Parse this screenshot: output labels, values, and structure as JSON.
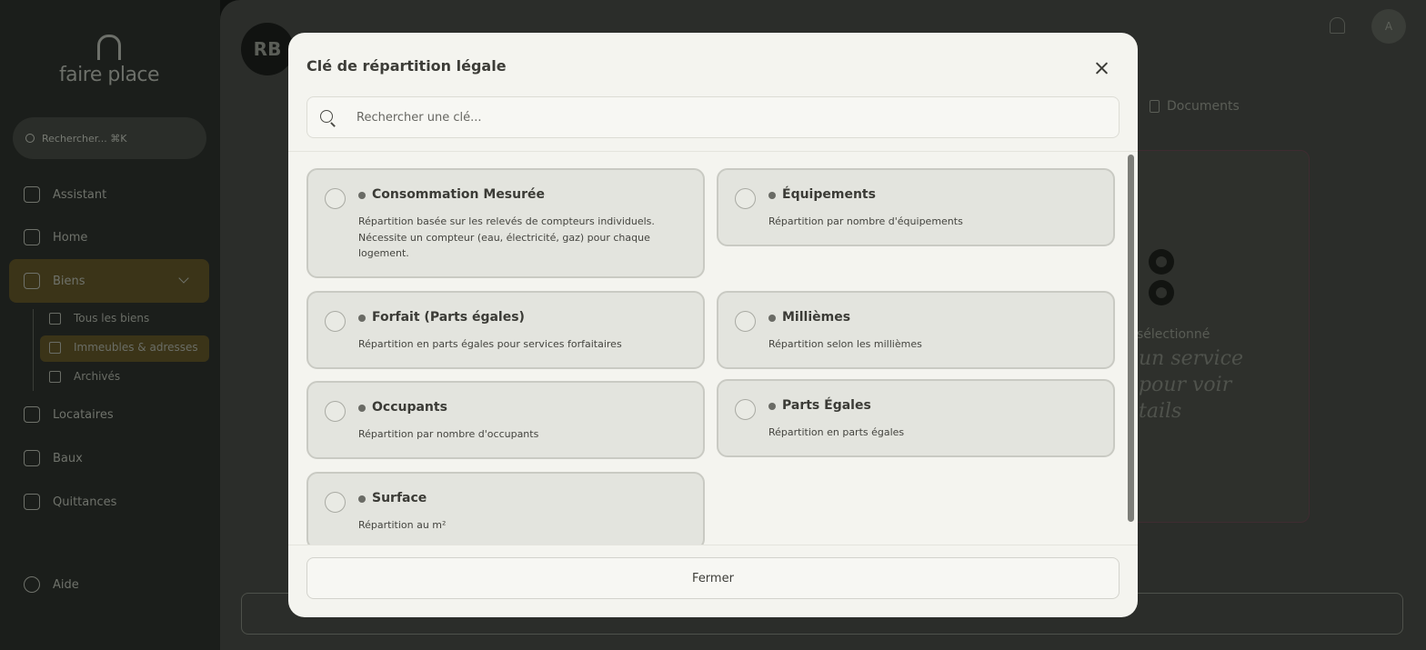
{
  "background": {
    "brand": "faire place",
    "search_placeholder": "Rechercher... ⌘K",
    "nav": [
      {
        "label": "Assistant",
        "icon": "sparkle-icon"
      },
      {
        "label": "Home",
        "icon": "home-icon"
      },
      {
        "label": "Biens",
        "icon": "building-icon"
      },
      {
        "label": "Locataires",
        "icon": "user-icon"
      },
      {
        "label": "Baux",
        "icon": "document-icon"
      },
      {
        "label": "Quittances",
        "icon": "receipt-icon"
      },
      {
        "label": "Aide",
        "icon": "help-icon"
      }
    ],
    "sub_nav": [
      {
        "label": "Tous les biens"
      },
      {
        "label": "Immeubles & adresses"
      },
      {
        "label": "Archivés"
      }
    ],
    "avatar_initials": "RB",
    "user_initial": "A",
    "documents_tab": "Documents",
    "selected_text": "sélectionné",
    "script_lines": [
      "un service",
      "pour voir",
      "tails"
    ]
  },
  "modal": {
    "title": "Clé de répartition légale",
    "search": {
      "placeholder": "Rechercher une clé...",
      "value": ""
    },
    "options": [
      {
        "title": "Consommation Mesurée",
        "description": "Répartition basée sur les relevés de compteurs individuels. Nécessite un compteur (eau, électricité, gaz) pour chaque logement."
      },
      {
        "title": "Équipements",
        "description": "Répartition par nombre d'équipements"
      },
      {
        "title": "Forfait (Parts égales)",
        "description": "Répartition en parts égales pour services forfaitaires"
      },
      {
        "title": "Millièmes",
        "description": "Répartition selon les millièmes"
      },
      {
        "title": "Occupants",
        "description": "Répartition par nombre d'occupants"
      },
      {
        "title": "Parts Égales",
        "description": "Répartition en parts égales"
      },
      {
        "title": "Surface",
        "description": "Répartition au m²"
      }
    ],
    "close_label": "Fermer"
  },
  "colors": {
    "overlay": "#0f110f",
    "modal_bg": "#f4f4ef",
    "card_bg": "#e3e4de",
    "card_border": "#c9cac3",
    "text": "#3b3b36"
  }
}
